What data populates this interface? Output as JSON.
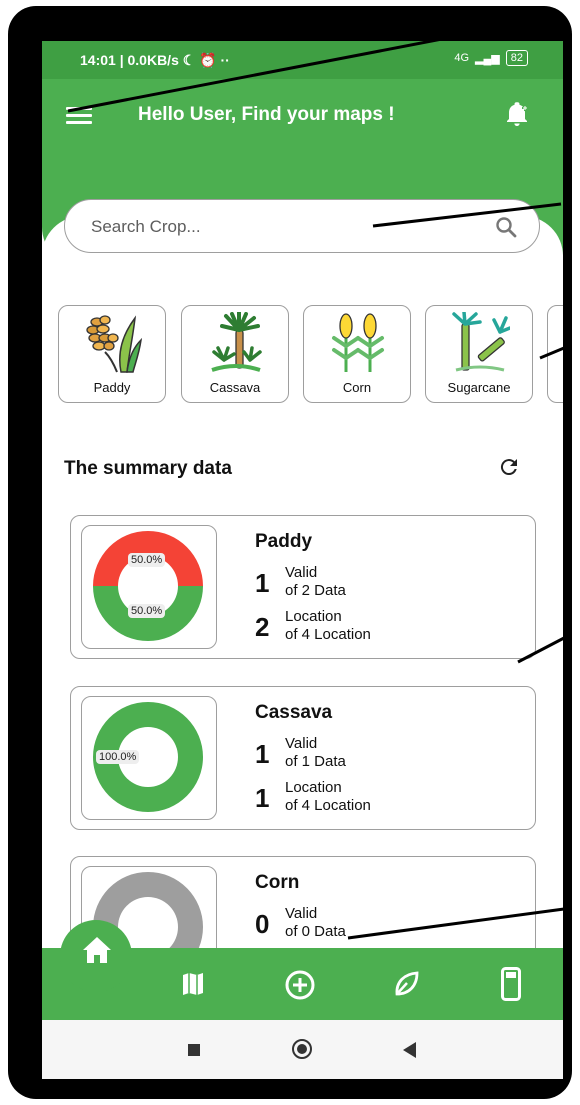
{
  "status_bar": {
    "time": "14:01 | 0.0KB/s ☾ ⏰ ··",
    "network": "4G",
    "signal": "▂▄▆",
    "battery": "82"
  },
  "header": {
    "title": "Hello User, Find your maps !"
  },
  "search": {
    "placeholder": "Search Crop..."
  },
  "crops": [
    {
      "label": "Paddy"
    },
    {
      "label": "Cassava"
    },
    {
      "label": "Corn"
    },
    {
      "label": "Sugarcane"
    }
  ],
  "summary": {
    "title": "The summary data"
  },
  "cards": [
    {
      "name": "Paddy",
      "valid_count": "1",
      "valid_label": "Valid",
      "valid_of": "of 2 Data",
      "location_count": "2",
      "location_label": "Location",
      "location_of": "of 4 Location",
      "segments": [
        {
          "pct_label": "50.0%",
          "fraction": 0.5,
          "color": "#f44336"
        },
        {
          "pct_label": "50.0%",
          "fraction": 0.5,
          "color": "#4caf50"
        }
      ]
    },
    {
      "name": "Cassava",
      "valid_count": "1",
      "valid_label": "Valid",
      "valid_of": "of 1 Data",
      "location_count": "1",
      "location_label": "Location",
      "location_of": "of 4 Location",
      "segments": [
        {
          "pct_label": "100.0%",
          "fraction": 1.0,
          "color": "#4caf50"
        }
      ]
    },
    {
      "name": "Corn",
      "valid_count": "0",
      "valid_label": "Valid",
      "valid_of": "of 0 Data",
      "segments": [
        {
          "fraction": 1.0,
          "color": "#9e9e9e"
        }
      ]
    }
  ],
  "bottom_nav": [
    "home-icon",
    "map-icon",
    "add-circle-icon",
    "leaf-icon",
    "phone-icon"
  ],
  "colors": {
    "primary": "#4caf50",
    "status_bar": "#3f9f43",
    "danger": "#f44336",
    "neutral": "#9e9e9e"
  }
}
